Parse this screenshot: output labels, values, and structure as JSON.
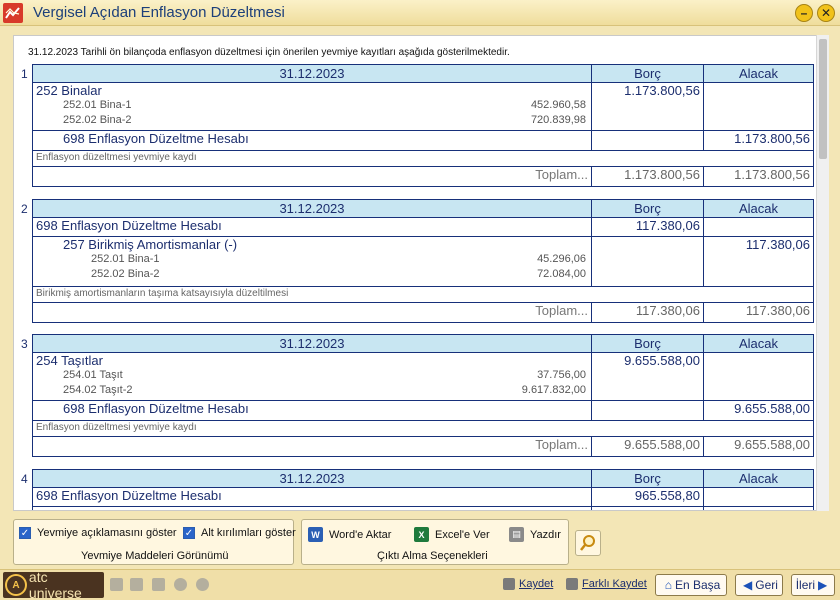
{
  "window": {
    "title": "Vergisel Açıdan Enflasyon Düzeltmesi"
  },
  "intro": "31.12.2023 Tarihli ön bilançoda enflasyon düzeltmesi için önerilen yevmiye kayıtları aşağıda gösterilmektedir.",
  "entries": [
    {
      "num": "1",
      "date": "31.12.2023",
      "borc_label": "Borç",
      "alacak_label": "Alacak",
      "debit": {
        "account": "252 Binalar",
        "amount": "1.173.800,56",
        "subs": [
          {
            "code": "252.01 Bina-1",
            "amount": "452.960,58"
          },
          {
            "code": "252.02 Bina-2",
            "amount": "720.839,98"
          }
        ]
      },
      "credit": {
        "account": "698 Enflasyon Düzeltme Hesabı",
        "amount": "1.173.800,56",
        "subs": []
      },
      "description": "Enflasyon düzeltmesi yevmiye kaydı",
      "total_label": "Toplam...",
      "total_borc": "1.173.800,56",
      "total_alacak": "1.173.800,56"
    },
    {
      "num": "2",
      "date": "31.12.2023",
      "borc_label": "Borç",
      "alacak_label": "Alacak",
      "debit": {
        "account": "698 Enflasyon Düzeltme Hesabı",
        "amount": "117.380,06",
        "subs": []
      },
      "credit": {
        "account": "257 Birikmiş Amortismanlar (-)",
        "amount": "117.380,06",
        "subs": [
          {
            "code": "252.01 Bina-1",
            "amount": "45.296,06"
          },
          {
            "code": "252.02 Bina-2",
            "amount": "72.084,00"
          }
        ]
      },
      "description": "Birikmiş amortismanların taşıma katsayısıyla düzeltilmesi",
      "total_label": "Toplam...",
      "total_borc": "117.380,06",
      "total_alacak": "117.380,06"
    },
    {
      "num": "3",
      "date": "31.12.2023",
      "borc_label": "Borç",
      "alacak_label": "Alacak",
      "debit": {
        "account": "254 Taşıtlar",
        "amount": "9.655.588,00",
        "subs": [
          {
            "code": "254.01 Taşıt",
            "amount": "37.756,00"
          },
          {
            "code": "254.02 Taşıt-2",
            "amount": "9.617.832,00"
          }
        ]
      },
      "credit": {
        "account": "698 Enflasyon Düzeltme Hesabı",
        "amount": "9.655.588,00",
        "subs": []
      },
      "description": "Enflasyon düzeltmesi yevmiye kaydı",
      "total_label": "Toplam...",
      "total_borc": "9.655.588,00",
      "total_alacak": "9.655.588,00"
    },
    {
      "num": "4",
      "date": "31.12.2023",
      "borc_label": "Borç",
      "alacak_label": "Alacak",
      "debit": {
        "account": "698 Enflasyon Düzeltme Hesabı",
        "amount": "965.558,80",
        "subs": []
      }
    }
  ],
  "view_group": {
    "label": "Yevmiye Maddeleri Görünümü",
    "show_desc": {
      "label": "Yevmiye açıklamasını göster",
      "checked": true
    },
    "show_sub": {
      "label": "Alt kırılımları göster",
      "checked": true
    }
  },
  "output_group": {
    "label": "Çıktı Alma Seçenekleri",
    "word": "Word'e Aktar",
    "excel": "Excel'e Ver",
    "print": "Yazdır"
  },
  "status": {
    "logo_text": "atc universe",
    "save": "Kaydet",
    "save_as": "Farklı Kaydet",
    "home": "En Başa",
    "back": "Geri",
    "next": "İleri"
  }
}
